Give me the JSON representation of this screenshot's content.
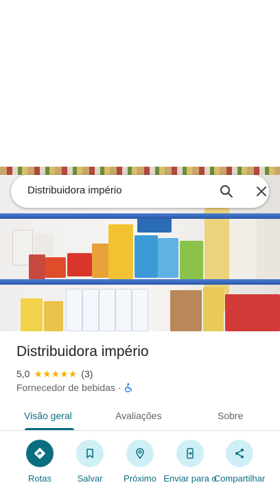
{
  "search": {
    "query": "Distribuidora império"
  },
  "place": {
    "title": "Distribuidora império",
    "rating": "5,0",
    "stars": 5,
    "review_count": "(3)",
    "category": "Fornecedor de bebidas",
    "separator": "·"
  },
  "tabs": [
    {
      "label": "Visão geral",
      "active": true
    },
    {
      "label": "Avaliações",
      "active": false
    },
    {
      "label": "Sobre",
      "active": false
    }
  ],
  "actions": [
    {
      "label": "Rotas",
      "icon": "directions-icon"
    },
    {
      "label": "Salvar",
      "icon": "bookmark-icon"
    },
    {
      "label": "Próximo",
      "icon": "nearby-icon"
    },
    {
      "label": "Enviar para o",
      "icon": "send-to-phone-icon"
    },
    {
      "label": "Compartilhar",
      "icon": "share-icon"
    }
  ],
  "colors": {
    "accent": "#0b6e80",
    "action_bg": "#cfeff7",
    "star": "#f4b400"
  }
}
